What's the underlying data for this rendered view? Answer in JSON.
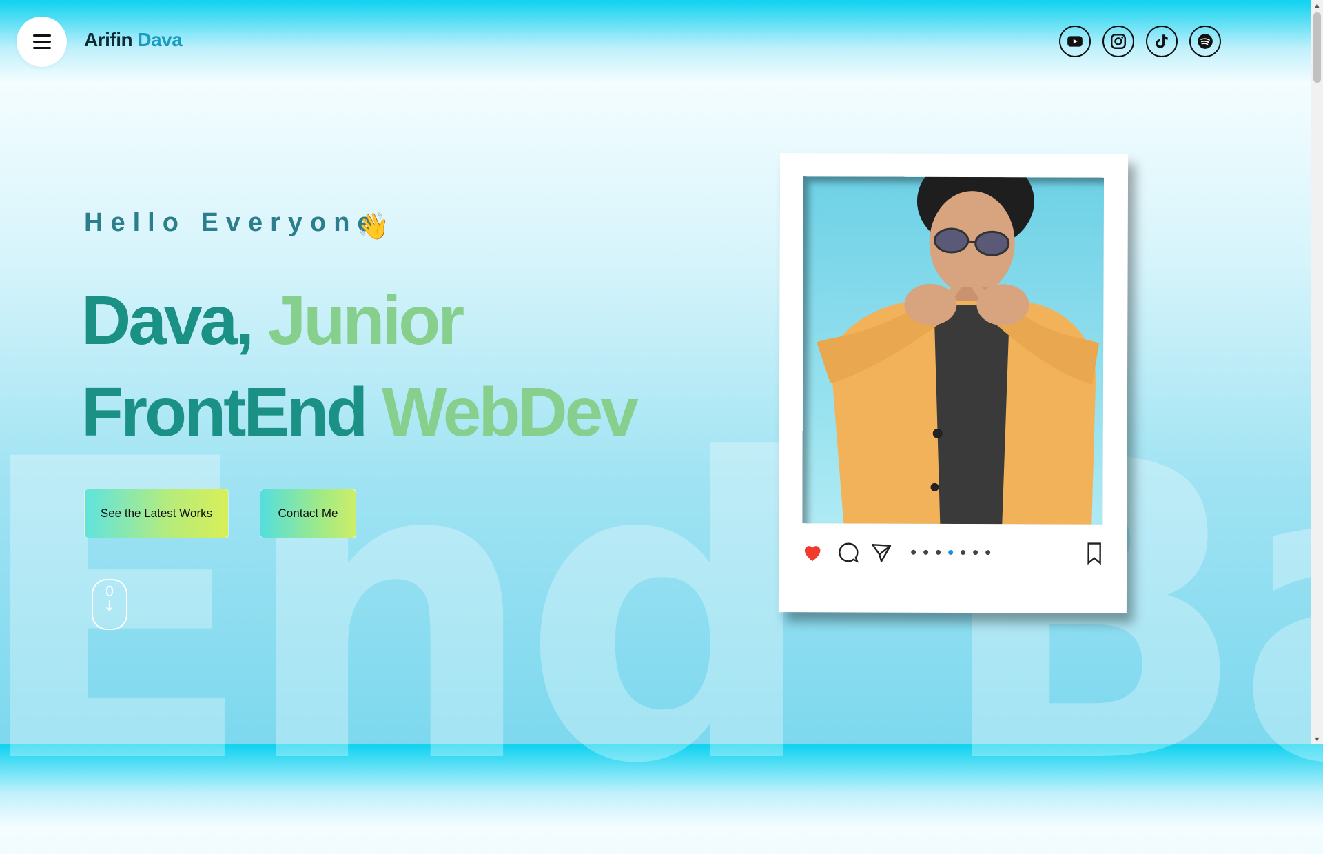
{
  "header": {
    "brand_first": "Arifin",
    "brand_second": "Dava",
    "menu_icon": "hamburger-icon",
    "socials": [
      {
        "name": "youtube",
        "icon": "youtube-icon"
      },
      {
        "name": "instagram",
        "icon": "instagram-icon"
      },
      {
        "name": "tiktok",
        "icon": "tiktok-icon"
      },
      {
        "name": "spotify",
        "icon": "spotify-icon"
      }
    ]
  },
  "hero": {
    "greeting": "Hello Everyone",
    "greeting_icon": "waving-hand-icon",
    "line1_part1": "Dava,",
    "line1_part2": "Junior",
    "line2_part1": "FrontEnd",
    "line2_part2": "WebDev",
    "background_text": "End Bac",
    "primary_button": "See the Latest Works",
    "secondary_button": "Contact Me",
    "scroll_indicator_value": "0"
  },
  "post_card": {
    "image_alt": "Portrait of Dava in yellow jacket making a hand-heart gesture",
    "icons": [
      "heart-icon",
      "comment-icon",
      "send-icon",
      "bookmark-icon"
    ],
    "carousel_count": 7,
    "carousel_active_index": 3,
    "liked": true
  },
  "colors": {
    "accent_dark": "#1b9186",
    "accent_light": "#86cf8c",
    "brand_accent": "#1a9bc0",
    "heart": "#f13b2c",
    "active_dot": "#1a8fe0"
  }
}
